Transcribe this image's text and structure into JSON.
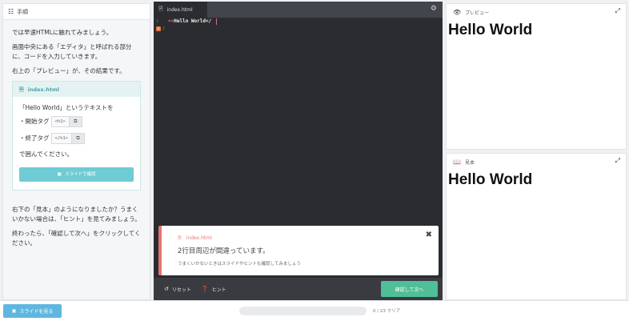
{
  "left": {
    "header": "手順",
    "intro": [
      "では早速HTMLに触れてみましょう。",
      "画面中央にある「エディタ」と呼ばれる部分に、コードを入力していきます。",
      "右上の「プレビュー」が、その結果です。"
    ],
    "card": {
      "file": "index.html",
      "line1": "「Hello World」というテキストを",
      "open_label": "・開始タグ",
      "open_tag": "<h1>",
      "close_label": "・終了タグ",
      "close_tag": "</h1>",
      "line_end": "で囲んでください。",
      "button": "スライドで確認"
    },
    "outro1": "右下の「見本」のようになりましたか？うまくいかない場合は、「ヒント」を見てみましょう。",
    "outro2": "終わったら、「確認して次へ」をクリックしてください。"
  },
  "editor": {
    "tab": "index.html",
    "lines": [
      {
        "num": "1",
        "code": "Hello World</"
      },
      {
        "num": "2",
        "code": ""
      }
    ],
    "error": {
      "file": "index.html",
      "title": "2行目周辺が間違っています。",
      "hint": "うまくいかないときはスライドやヒントも確認してみましょう"
    },
    "footer": {
      "reset": "リセット",
      "hint": "ヒント",
      "next": "確認して次へ"
    }
  },
  "preview": {
    "label": "プレビュー",
    "content": "Hello World"
  },
  "sample": {
    "label": "見本",
    "content": "Hello World"
  },
  "bottom": {
    "slides_button": "スライドを見る",
    "progress_text": "0 / 23 クリア",
    "progress_fraction": 0
  },
  "colors": {
    "accent_green": "#4fbf98",
    "accent_teal": "#6fcbd4",
    "error_red": "#e57373",
    "slides_blue": "#5fb7df"
  }
}
